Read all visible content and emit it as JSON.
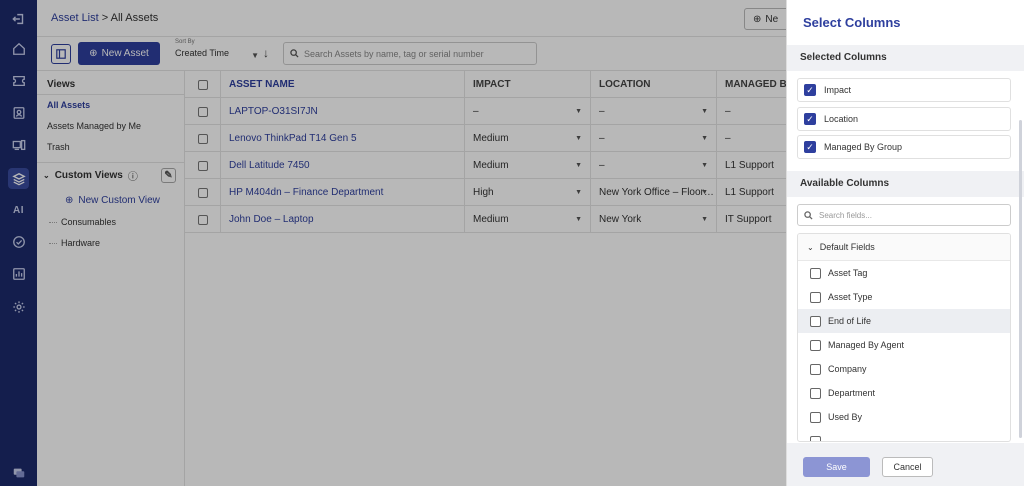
{
  "rail": {
    "icons": [
      "logout-icon",
      "home-icon",
      "ticket-icon",
      "contacts-icon",
      "assets-icon",
      "layers-icon",
      "ai-icon",
      "check-circle-icon",
      "reports-icon",
      "settings-icon",
      "chat-icon"
    ],
    "ai_label": "AI",
    "active": "layers-icon"
  },
  "header": {
    "breadcrumb_link": "Asset List",
    "breadcrumb_sep": " > ",
    "breadcrumb_current": "All Assets",
    "new_button_label": "Ne"
  },
  "toolbar": {
    "new_asset_label": "New Asset",
    "sort_caption": "Sort By",
    "sort_value": "Created Time",
    "search_placeholder": "Search Assets by name, tag or serial number"
  },
  "views": {
    "title": "Views",
    "items": [
      {
        "label": "All Assets",
        "active": true
      },
      {
        "label": "Assets Managed by Me",
        "active": false
      },
      {
        "label": "Trash",
        "active": false
      }
    ],
    "custom_views_label": "Custom Views",
    "new_custom_view_label": "New Custom View",
    "groups": [
      "Consumables",
      "Hardware"
    ]
  },
  "table": {
    "columns": [
      "ASSET NAME",
      "IMPACT",
      "LOCATION",
      "MANAGED BY GR"
    ],
    "rows": [
      {
        "name": "LAPTOP-O31SI7JN",
        "impact": "–",
        "location": "–",
        "group": "–"
      },
      {
        "name": "Lenovo ThinkPad T14 Gen 5",
        "impact": "Medium",
        "location": "–",
        "group": "–"
      },
      {
        "name": "Dell Latitude 7450",
        "impact": "Medium",
        "location": "–",
        "group": "L1 Support"
      },
      {
        "name": "HP M404dn – Finance Department",
        "impact": "High",
        "location": "New York Office – Floor…",
        "group": "L1 Support"
      },
      {
        "name": "John Doe – Laptop",
        "impact": "Medium",
        "location": "New York",
        "group": "IT Support"
      }
    ]
  },
  "panel": {
    "title": "Select Columns",
    "selected_heading": "Selected Columns",
    "selected": [
      "Impact",
      "Location",
      "Managed By Group"
    ],
    "available_heading": "Available Columns",
    "search_placeholder": "Search fields...",
    "default_fields_label": "Default Fields",
    "fields": [
      "Asset Tag",
      "Asset Type",
      "End of Life",
      "Managed By Agent",
      "Company",
      "Department",
      "Used By"
    ],
    "save_label": "Save",
    "cancel_label": "Cancel"
  }
}
